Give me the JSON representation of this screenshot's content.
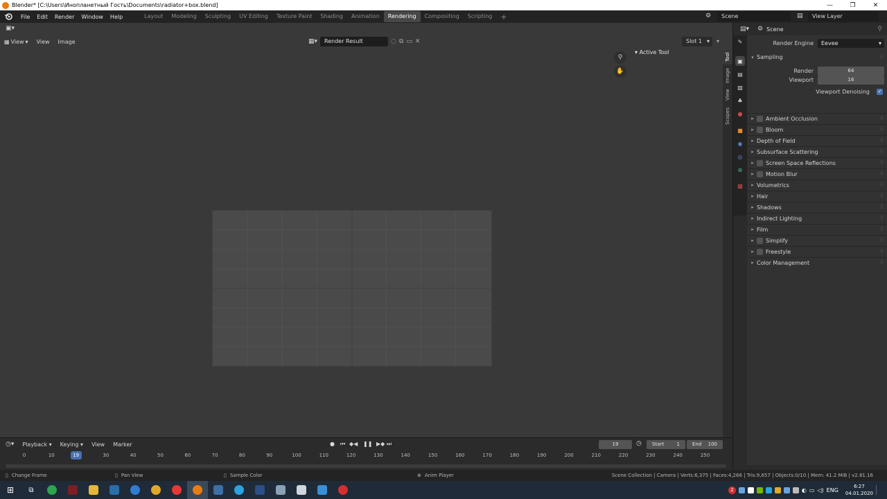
{
  "window": {
    "title": "Blender* [C:\\Users\\Инопланетный Гость\\Documents\\radiator+box.blend]",
    "controls": [
      "—",
      "❐",
      "✕"
    ]
  },
  "menu": [
    "File",
    "Edit",
    "Render",
    "Window",
    "Help"
  ],
  "workspaces": {
    "tabs": [
      "Layout",
      "Modeling",
      "Sculpting",
      "UV Editing",
      "Texture Paint",
      "Shading",
      "Animation",
      "Rendering",
      "Compositing",
      "Scripting"
    ],
    "active": "Rendering",
    "add": "+"
  },
  "scene": {
    "name": "Scene",
    "view_layer": "View Layer"
  },
  "image_editor": {
    "view_dd": "View",
    "menus": [
      "View",
      "Image"
    ],
    "render_result": "Render Result",
    "slot": "Slot 1",
    "active_tool": "Active Tool",
    "side_tabs": [
      "Tool",
      "Image",
      "View",
      "Scopes"
    ]
  },
  "properties": {
    "header": "Scene",
    "render_engine_label": "Render Engine",
    "render_engine": "Eevee",
    "sampling": "Sampling",
    "render_label": "Render",
    "render_value": "64",
    "viewport_label": "Viewport",
    "viewport_value": "16",
    "viewport_denoising": "Viewport Denoising",
    "panels": [
      {
        "label": "Ambient Occlusion",
        "checkbox": true
      },
      {
        "label": "Bloom",
        "checkbox": true
      },
      {
        "label": "Depth of Field",
        "checkbox": false
      },
      {
        "label": "Subsurface Scattering",
        "checkbox": false
      },
      {
        "label": "Screen Space Reflections",
        "checkbox": true
      },
      {
        "label": "Motion Blur",
        "checkbox": true
      },
      {
        "label": "Volumetrics",
        "checkbox": false
      },
      {
        "label": "Hair",
        "checkbox": false
      },
      {
        "label": "Shadows",
        "checkbox": false
      },
      {
        "label": "Indirect Lighting",
        "checkbox": false
      },
      {
        "label": "Film",
        "checkbox": false
      },
      {
        "label": "Simplify",
        "checkbox": true
      },
      {
        "label": "Freestyle",
        "checkbox": true
      },
      {
        "label": "Color Management",
        "checkbox": false
      }
    ]
  },
  "timeline": {
    "menus": [
      "Playback",
      "Keying",
      "View",
      "Marker"
    ],
    "current_frame": "19",
    "start_label": "Start",
    "start": "1",
    "end_label": "End",
    "end": "100",
    "ticks": [
      "0",
      "10",
      "19",
      "30",
      "40",
      "50",
      "60",
      "70",
      "80",
      "90",
      "100",
      "110",
      "120",
      "130",
      "140",
      "150",
      "160",
      "170",
      "180",
      "190",
      "200",
      "210",
      "220",
      "230",
      "240",
      "250"
    ]
  },
  "status": {
    "left": "Change Frame",
    "middle": "Pan View",
    "right": "Sample Color",
    "anim": "Anim Player",
    "info": "Scene Collection | Camera | Verts:6,375 | Faces:4,266 | Tris:9,657 | Objects:0/10 | Mem: 41.2 MiB | v2.81.16"
  },
  "taskbar": {
    "lang": "ENG",
    "time": "6:27",
    "date": "04.01.2020",
    "badge": "2"
  },
  "colors": {
    "accent": "#4772b3",
    "blender_orange": "#e87d0d"
  }
}
